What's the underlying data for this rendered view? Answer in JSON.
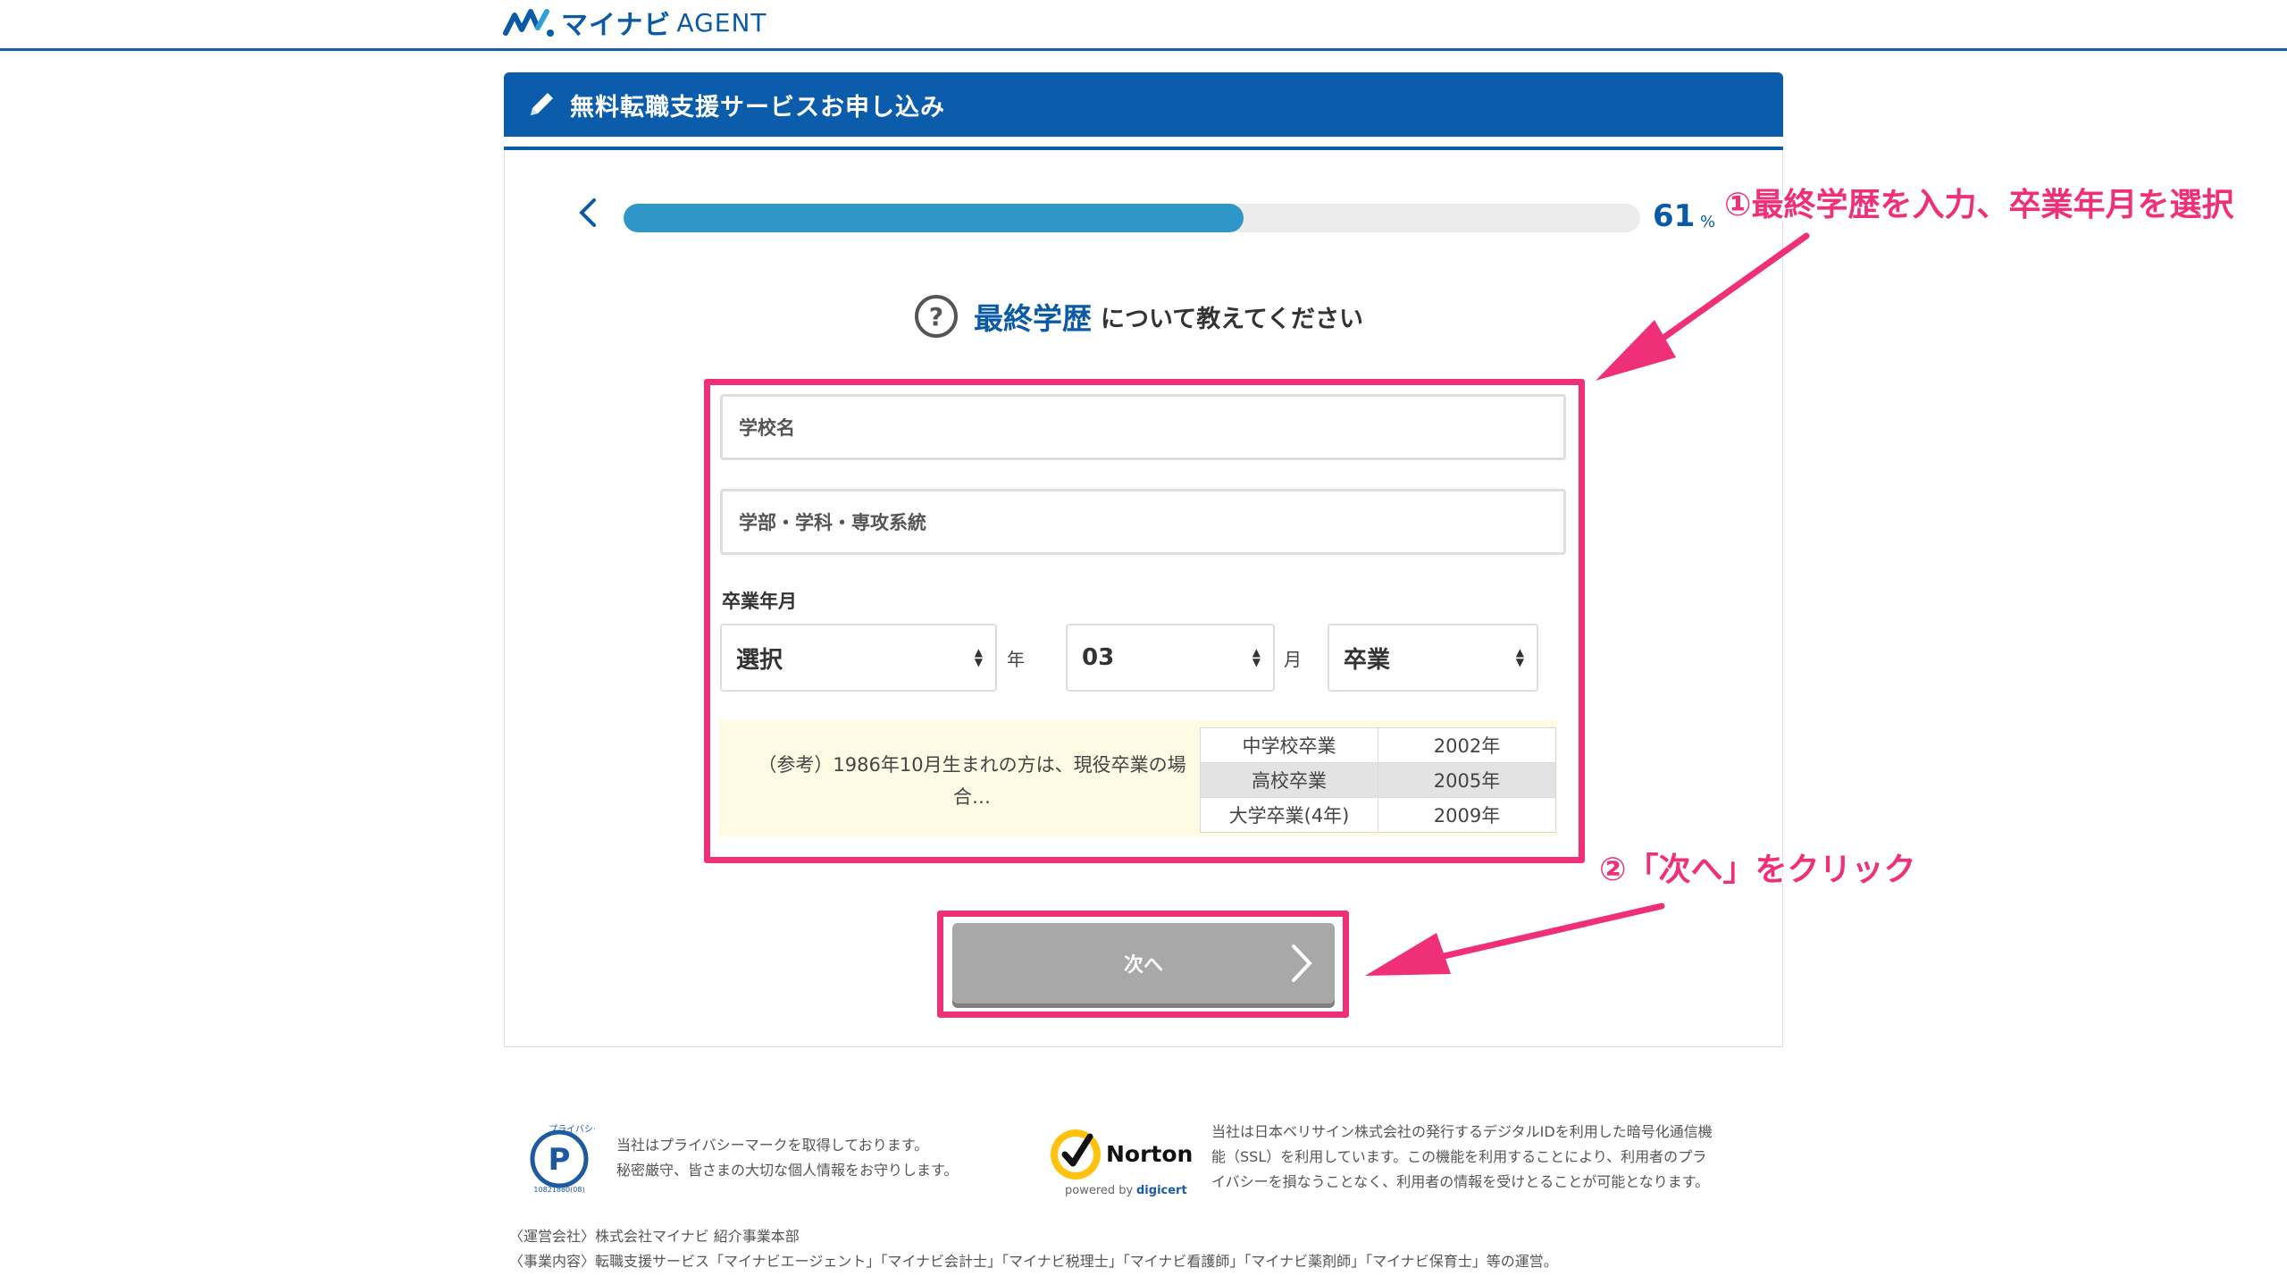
{
  "header": {
    "logo_text": "マイナビ",
    "logo_suffix": "AGENT"
  },
  "form_title": "無料転職支援サービスお申し込み",
  "progress": {
    "percent": 61,
    "percent_label": "61",
    "percent_sign": "%"
  },
  "question": {
    "highlight": "最終学歴",
    "rest": "について教えてください"
  },
  "fields": {
    "school_placeholder": "学校名",
    "faculty_placeholder": "学部・学科・専攻系統",
    "graduation_label": "卒業年月",
    "year_value": "選択",
    "year_unit": "年",
    "month_value": "03",
    "month_unit": "月",
    "status_value": "卒業"
  },
  "reference": {
    "text": "（参考）1986年10月生まれの方は、現役卒業の場合…",
    "rows": [
      {
        "label": "中学校卒業",
        "year": "2002年"
      },
      {
        "label": "高校卒業",
        "year": "2005年"
      },
      {
        "label": "大学卒業(4年)",
        "year": "2009年"
      }
    ]
  },
  "next_button_label": "次へ",
  "annotations": {
    "step1": "①最終学歴を入力、卒業年月を選択",
    "step2": "②「次へ」をクリック"
  },
  "footer": {
    "privacy_line1": "当社はプライバシーマークを取得しております。",
    "privacy_line2": "秘密厳守、皆さまの大切な個人情報をお守りします。",
    "privacy_mark_text": "プライバシー",
    "privacy_mark_number": "10821880(08)",
    "norton_brand": "Norton",
    "norton_powered": "powered by",
    "norton_digicert": "digicert",
    "ssl_line1": "当社は日本ベリサイン株式会社の発行するデジタルIDを利用した暗号化通信機",
    "ssl_line2": "能（SSL）を利用しています。この機能を利用することにより、利用者のプラ",
    "ssl_line3": "イバシーを損なうことなく、利用者の情報を受けとることが可能となります。",
    "company": "〈運営会社〉株式会社マイナビ 紹介事業本部",
    "business": "〈事業内容〉転職支援サービス「マイナビエージェント」「マイナビ会計士」「マイナビ税理士」「マイナビ看護師」「マイナビ薬剤師」「マイナビ保育士」等の運営。"
  },
  "colors": {
    "brand_blue": "#0b5cab",
    "progress_fill": "#2f96c8",
    "annotation_pink": "#ef2f78"
  }
}
